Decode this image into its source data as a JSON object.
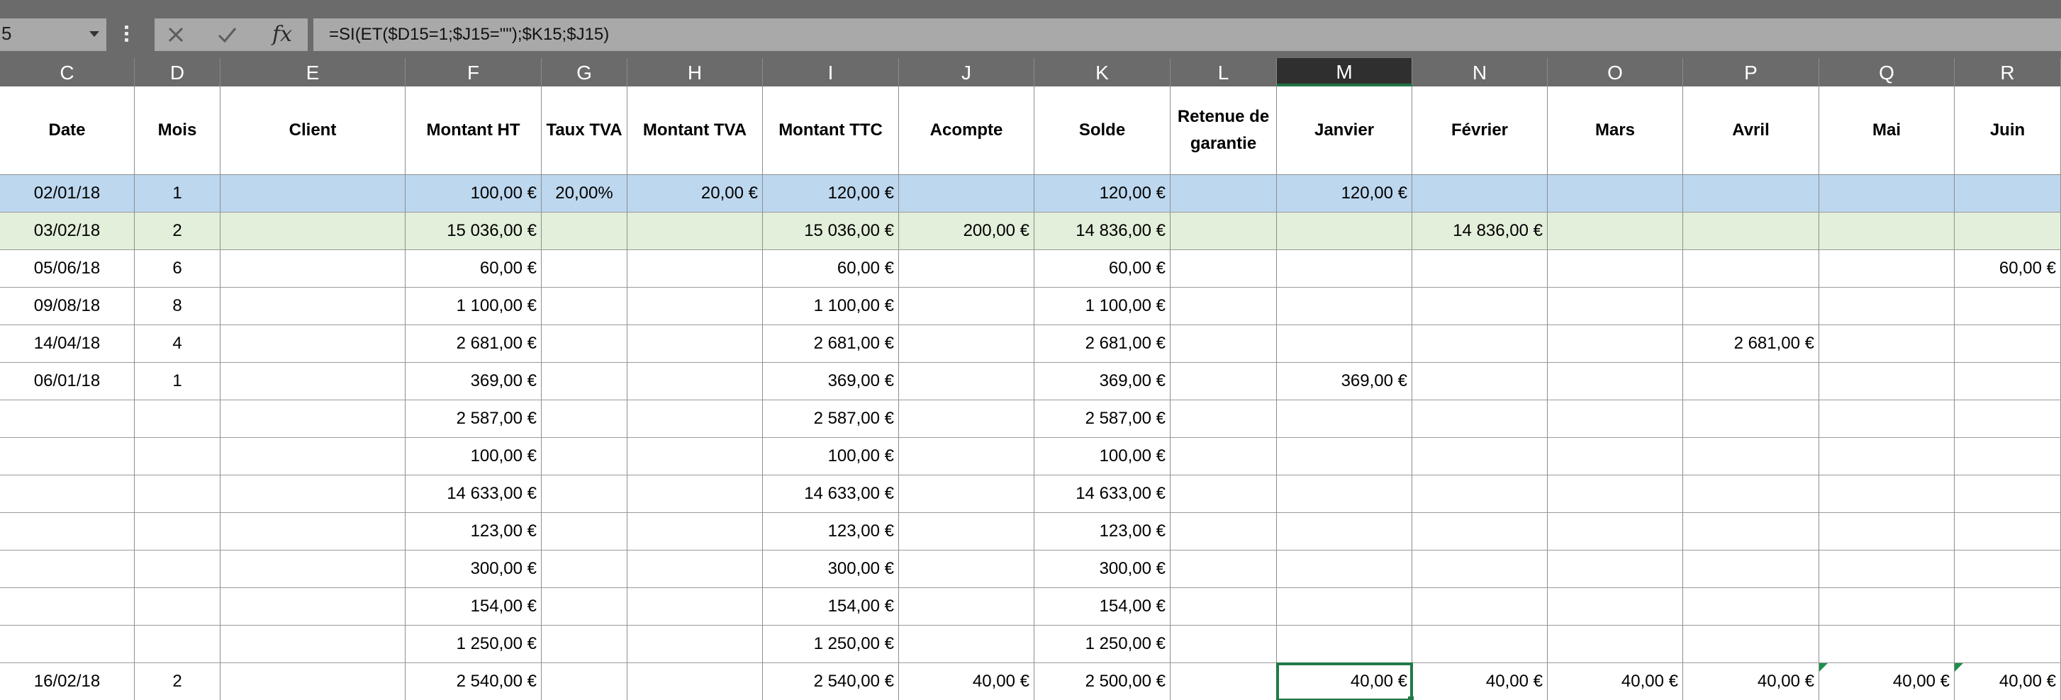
{
  "formula_bar": {
    "name_box": "5",
    "formula": "=SI(ET($D15=1;$J15=\"\");$K15;$J15)"
  },
  "icons": [
    "more-options-icon",
    "cancel-icon",
    "enter-check-icon",
    "insert-function-icon",
    "dropdown-arrow-icon"
  ],
  "fx_label": "fx",
  "columns": [
    "C",
    "D",
    "E",
    "F",
    "G",
    "H",
    "I",
    "J",
    "K",
    "L",
    "M",
    "N",
    "O",
    "P",
    "Q",
    "R"
  ],
  "active_column": "M",
  "headers": [
    "Date",
    "Mois",
    "Client",
    "Montant HT",
    "Taux TVA",
    "Montant TVA",
    "Montant TTC",
    "Acompte",
    "Solde",
    "Retenue de garantie",
    "Janvier",
    "Février",
    "Mars",
    "Avril",
    "Mai",
    "Juin"
  ],
  "colors": {
    "header_bar": "#6b6b6b",
    "row_blue": "#bdd7ee",
    "row_green": "#e2efda",
    "selection": "#1f7a46"
  },
  "rows": [
    {
      "fill": "blue",
      "cells": [
        "02/01/18",
        "1",
        "",
        "100,00 €",
        "20,00%",
        "20,00 €",
        "120,00 €",
        "",
        "120,00 €",
        "",
        "120,00 €",
        "",
        "",
        "",
        "",
        ""
      ]
    },
    {
      "fill": "green",
      "cells": [
        "03/02/18",
        "2",
        "",
        "15 036,00 €",
        "",
        "",
        "15 036,00 €",
        "200,00 €",
        "14 836,00 €",
        "",
        "",
        "14 836,00 €",
        "",
        "",
        "",
        ""
      ]
    },
    {
      "fill": "",
      "cells": [
        "05/06/18",
        "6",
        "",
        "60,00 €",
        "",
        "",
        "60,00 €",
        "",
        "60,00 €",
        "",
        "",
        "",
        "",
        "",
        "",
        "60,00 €"
      ]
    },
    {
      "fill": "",
      "cells": [
        "09/08/18",
        "8",
        "",
        "1 100,00 €",
        "",
        "",
        "1 100,00 €",
        "",
        "1 100,00 €",
        "",
        "",
        "",
        "",
        "",
        "",
        ""
      ]
    },
    {
      "fill": "",
      "cells": [
        "14/04/18",
        "4",
        "",
        "2 681,00 €",
        "",
        "",
        "2 681,00 €",
        "",
        "2 681,00 €",
        "",
        "",
        "",
        "",
        "2 681,00 €",
        "",
        ""
      ]
    },
    {
      "fill": "",
      "cells": [
        "06/01/18",
        "1",
        "",
        "369,00 €",
        "",
        "",
        "369,00 €",
        "",
        "369,00 €",
        "",
        "369,00 €",
        "",
        "",
        "",
        "",
        ""
      ]
    },
    {
      "fill": "",
      "cells": [
        "",
        "",
        "",
        "2 587,00 €",
        "",
        "",
        "2 587,00 €",
        "",
        "2 587,00 €",
        "",
        "",
        "",
        "",
        "",
        "",
        ""
      ]
    },
    {
      "fill": "",
      "cells": [
        "",
        "",
        "",
        "100,00 €",
        "",
        "",
        "100,00 €",
        "",
        "100,00 €",
        "",
        "",
        "",
        "",
        "",
        "",
        ""
      ]
    },
    {
      "fill": "",
      "cells": [
        "",
        "",
        "",
        "14 633,00 €",
        "",
        "",
        "14 633,00 €",
        "",
        "14 633,00 €",
        "",
        "",
        "",
        "",
        "",
        "",
        ""
      ]
    },
    {
      "fill": "",
      "cells": [
        "",
        "",
        "",
        "123,00 €",
        "",
        "",
        "123,00 €",
        "",
        "123,00 €",
        "",
        "",
        "",
        "",
        "",
        "",
        ""
      ]
    },
    {
      "fill": "",
      "cells": [
        "",
        "",
        "",
        "300,00 €",
        "",
        "",
        "300,00 €",
        "",
        "300,00 €",
        "",
        "",
        "",
        "",
        "",
        "",
        ""
      ]
    },
    {
      "fill": "",
      "cells": [
        "",
        "",
        "",
        "154,00 €",
        "",
        "",
        "154,00 €",
        "",
        "154,00 €",
        "",
        "",
        "",
        "",
        "",
        "",
        ""
      ]
    },
    {
      "fill": "",
      "cells": [
        "",
        "",
        "",
        "1 250,00 €",
        "",
        "",
        "1 250,00 €",
        "",
        "1 250,00 €",
        "",
        "",
        "",
        "",
        "",
        "",
        ""
      ]
    },
    {
      "fill": "",
      "cells": [
        "16/02/18",
        "2",
        "",
        "2 540,00 €",
        "",
        "",
        "2 540,00 €",
        "40,00 €",
        "2 500,00 €",
        "",
        "40,00 €",
        "40,00 €",
        "40,00 €",
        "40,00 €",
        "40,00 €",
        "40,00 €"
      ]
    }
  ],
  "selected_cell": {
    "row": 14,
    "column": "M"
  },
  "error_indicators": [
    {
      "row": 14,
      "column": "Q"
    },
    {
      "row": 14,
      "column": "R"
    }
  ]
}
